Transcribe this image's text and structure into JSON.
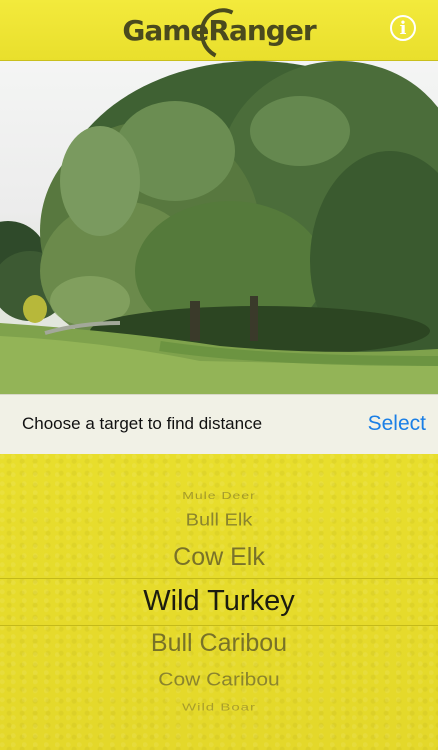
{
  "header": {
    "logo_game": "Game",
    "logo_ranger": "Ranger",
    "info_icon": "info-icon",
    "info_glyph": "i"
  },
  "instruction": {
    "prompt": "Choose a target to find distance",
    "select_label": "Select"
  },
  "picker": {
    "items": [
      "Mule Deer",
      "Bull Elk",
      "Cow Elk",
      "Wild Turkey",
      "Bull Caribou",
      "Cow Caribou",
      "Wild Boar"
    ],
    "selected": "Wild Turkey"
  },
  "colors": {
    "header_yellow": "#efe635",
    "picker_yellow": "#e6dc2a",
    "select_blue": "#1a7fe6"
  }
}
